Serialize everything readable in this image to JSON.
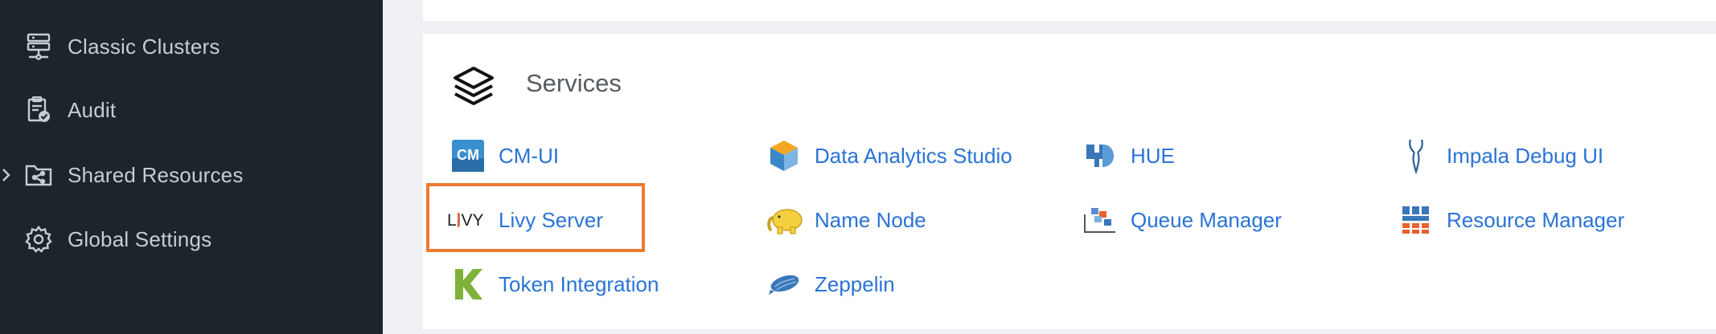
{
  "sidebar": {
    "items": [
      {
        "label": "Classic Clusters",
        "icon": "server-stack-icon"
      },
      {
        "label": "Audit",
        "icon": "clipboard-check-icon"
      },
      {
        "label": "Shared Resources",
        "icon": "shared-folder-icon",
        "expandable": true
      },
      {
        "label": "Global Settings",
        "icon": "gear-icon"
      }
    ]
  },
  "services": {
    "title": "Services",
    "title_icon": "layers-icon",
    "items": [
      {
        "label": "CM-UI",
        "icon": "cm-logo-icon"
      },
      {
        "label": "Data Analytics Studio",
        "icon": "cube-logo-icon"
      },
      {
        "label": "HUE",
        "icon": "hue-logo-icon"
      },
      {
        "label": "Impala Debug UI",
        "icon": "impala-antelope-icon"
      },
      {
        "label": "Livy Server",
        "icon": "livy-logo-icon",
        "icon_text": "LIVY"
      },
      {
        "label": "Name Node",
        "icon": "hadoop-elephant-icon"
      },
      {
        "label": "Queue Manager",
        "icon": "queue-manager-icon"
      },
      {
        "label": "Resource Manager",
        "icon": "resource-manager-grid-icon"
      },
      {
        "label": "Token Integration",
        "icon": "token-k-icon"
      },
      {
        "label": "Zeppelin",
        "icon": "zeppelin-blimp-icon"
      }
    ]
  },
  "colors": {
    "sidebar_bg": "#1c2529",
    "link": "#2a73d6",
    "highlight": "#ee7a2f"
  }
}
